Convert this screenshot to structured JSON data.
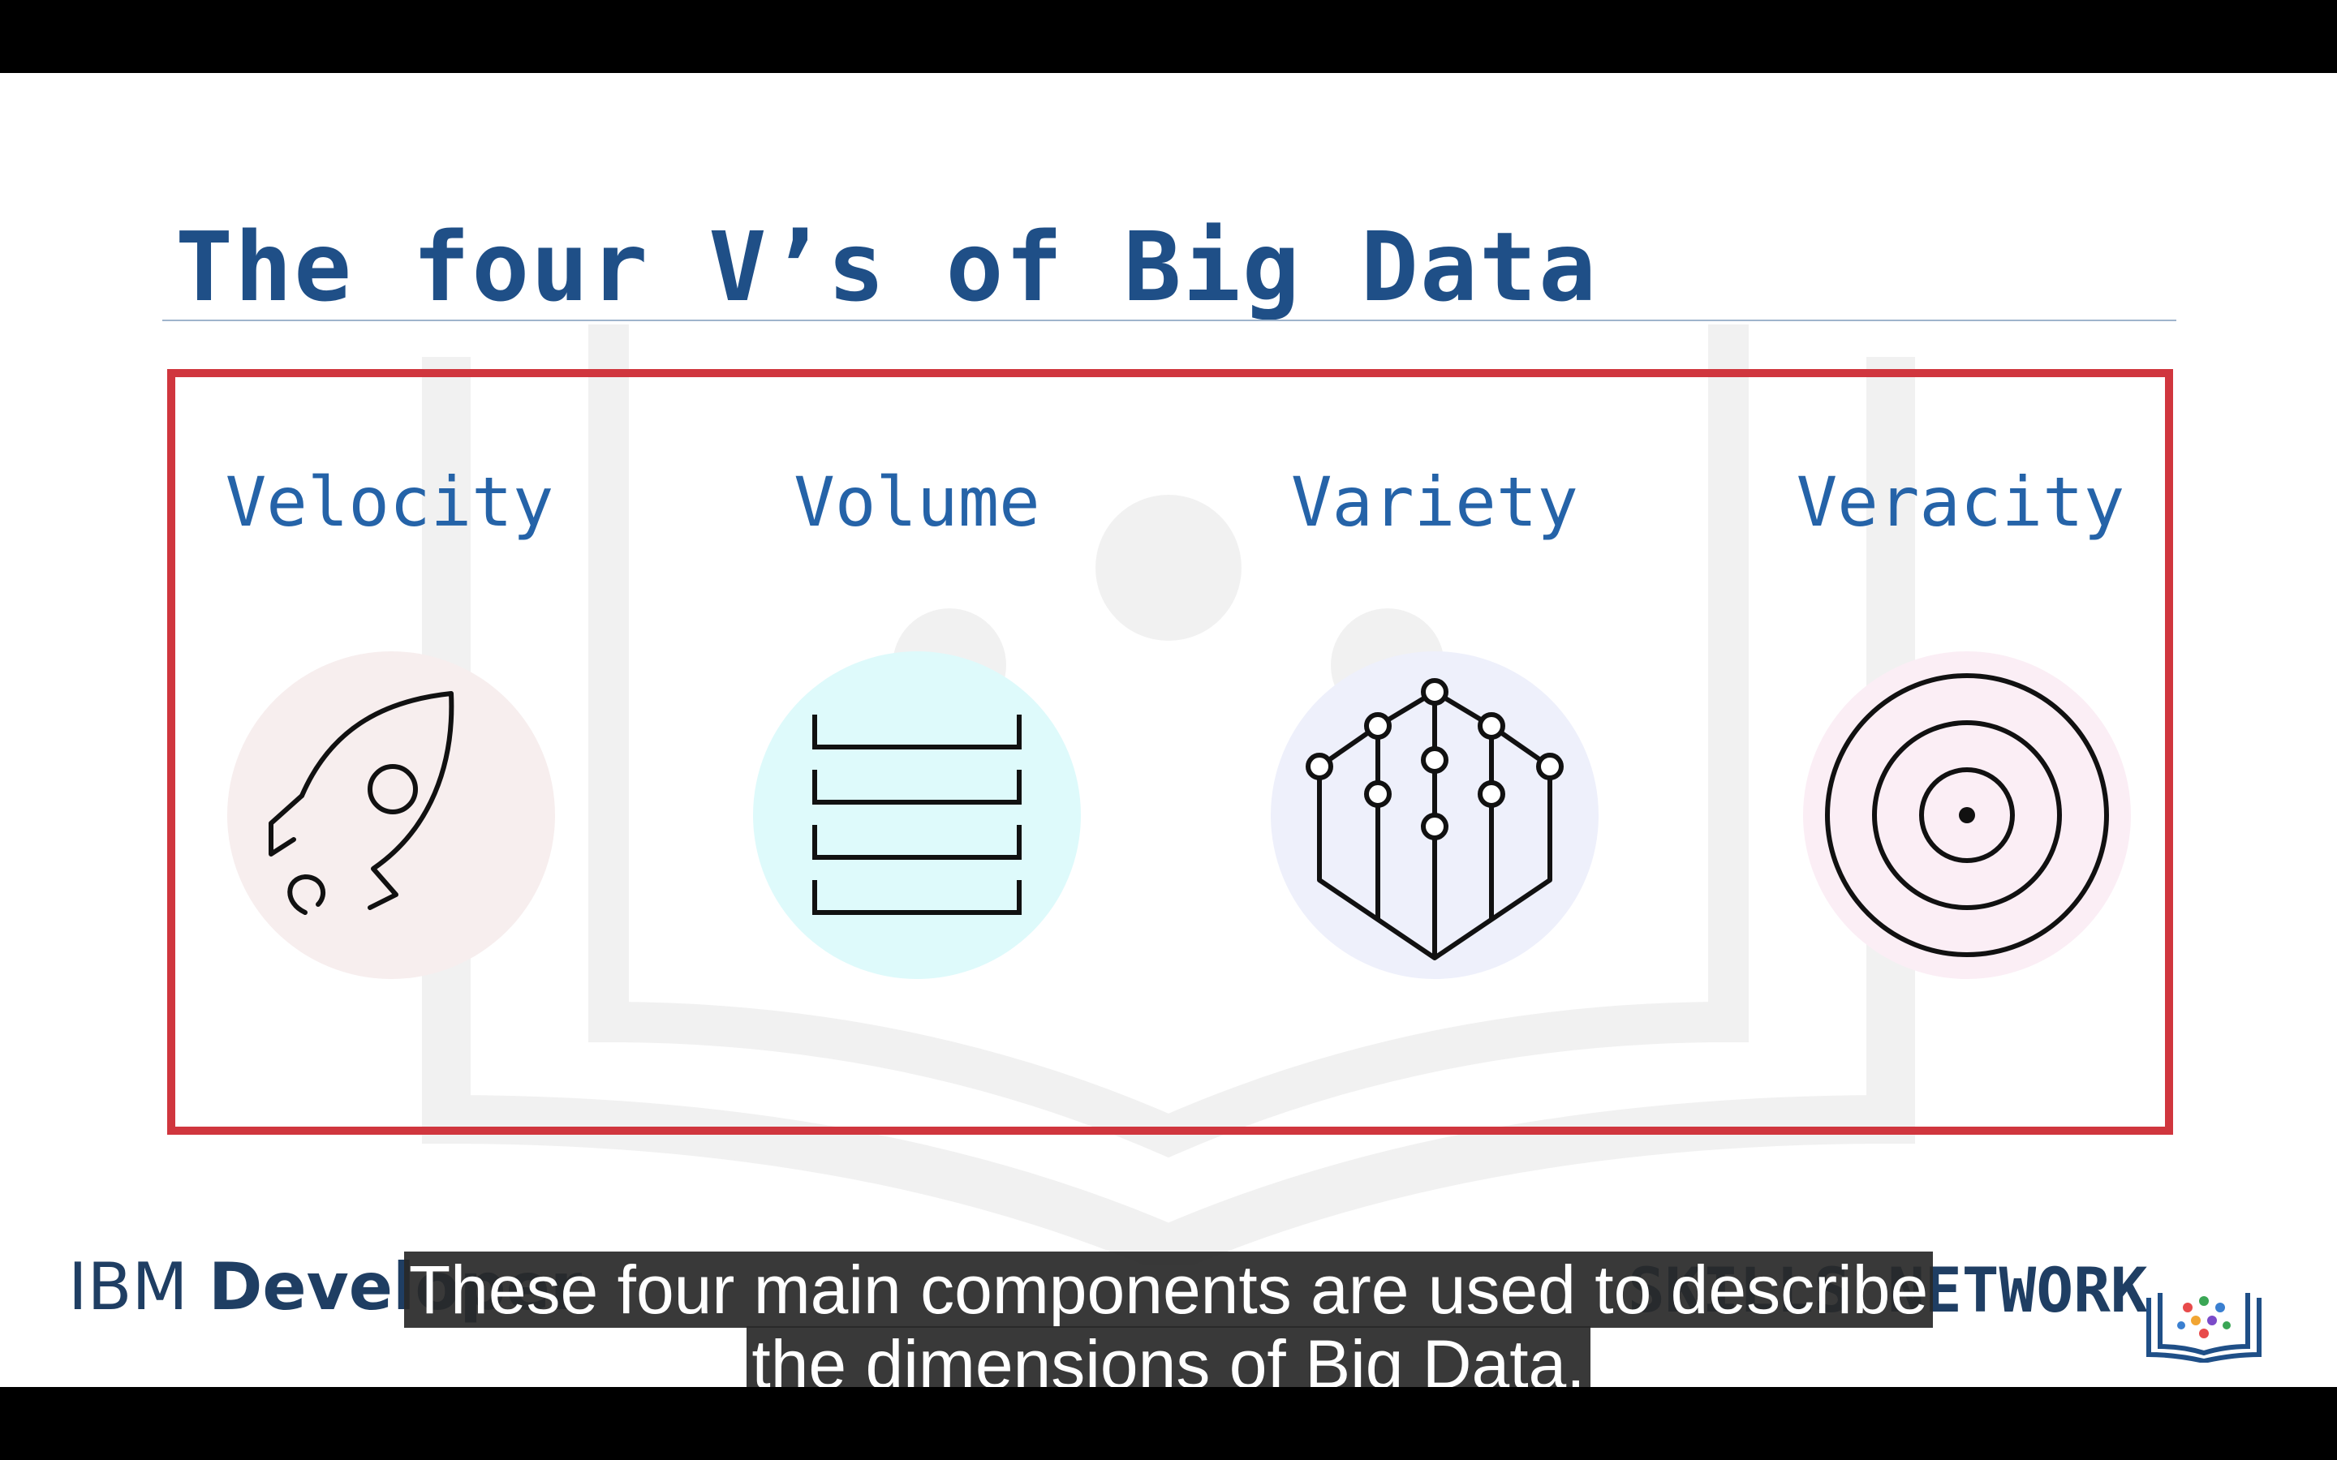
{
  "slide": {
    "title": "The four V’s of Big Data",
    "columns": [
      {
        "label": "Velocity",
        "icon": "rocket-icon",
        "tint": "#f7eeee"
      },
      {
        "label": "Volume",
        "icon": "stacked-layers-icon",
        "tint": "#defafb"
      },
      {
        "label": "Variety",
        "icon": "network-hexagon-icon",
        "tint": "#eef0fb"
      },
      {
        "label": "Veracity",
        "icon": "target-icon",
        "tint": "#fbeef5"
      }
    ],
    "frame_color": "#d0363e",
    "title_color": "#1f4f87",
    "label_color": "#2563a8"
  },
  "branding": {
    "ibm_prefix": "IBM",
    "ibm_suffix": "Developer",
    "skills_network": "SKILLS NETWORK"
  },
  "caption": {
    "line1": "These four main components are used to describe",
    "line2": "the dimensions of Big Data."
  }
}
